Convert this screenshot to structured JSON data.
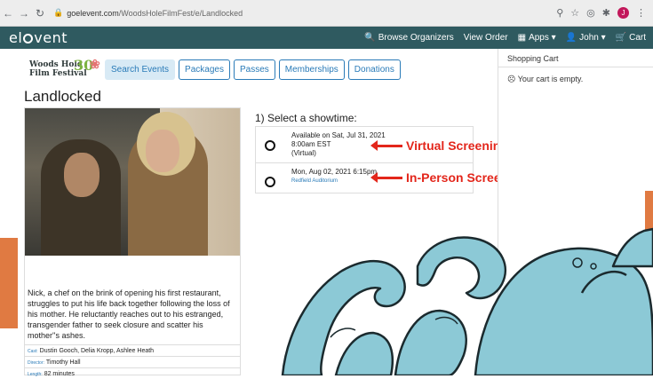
{
  "browser": {
    "url_domain": "goelevent.com",
    "url_path": "/WoodsHoleFilmFest/e/Landlocked",
    "avatar_letter": "J"
  },
  "appbar": {
    "logo": "elevent",
    "browse": "Browse Organizers",
    "view_order": "View Order",
    "apps": "Apps",
    "user": "John",
    "cart": "Cart"
  },
  "festival_logo": {
    "line1": "Woods Hole",
    "line2": "Film Festival",
    "number": "30"
  },
  "tabs": [
    "Search Events",
    "Packages",
    "Passes",
    "Memberships",
    "Donations"
  ],
  "event": {
    "title": "Landlocked",
    "description": "Nick, a chef on the brink of opening his first restaurant, struggles to put his life back together following the loss of his mother. He reluctantly reaches out to his estranged, transgender father to seek closure and scatter his mother''s ashes.",
    "cast_label": "Cast:",
    "cast": "Dustin Gooch, Delia Kropp, Ashlee Heath",
    "director_label": "Director:",
    "director": "Timothy Hall",
    "length_label": "Length:",
    "length": "82 minutes"
  },
  "showtimes": {
    "heading": "1) Select a showtime:",
    "items": [
      {
        "line1": "Available on Sat, Jul 31, 2021",
        "line2": "8:00am EST",
        "line3": "(Virtual)",
        "callout": "Virtual Screening"
      },
      {
        "line1": "Mon, Aug 02, 2021 6:15pm",
        "venue": "Redfield Auditorium",
        "callout": "In-Person Screening"
      }
    ]
  },
  "cart": {
    "heading": "Shopping Cart",
    "empty_text": "Your cart is empty."
  },
  "colors": {
    "appbar": "#2f5a60",
    "accent": "#2a7bb8",
    "callout": "#e3261b",
    "orange": "#e07a42"
  }
}
